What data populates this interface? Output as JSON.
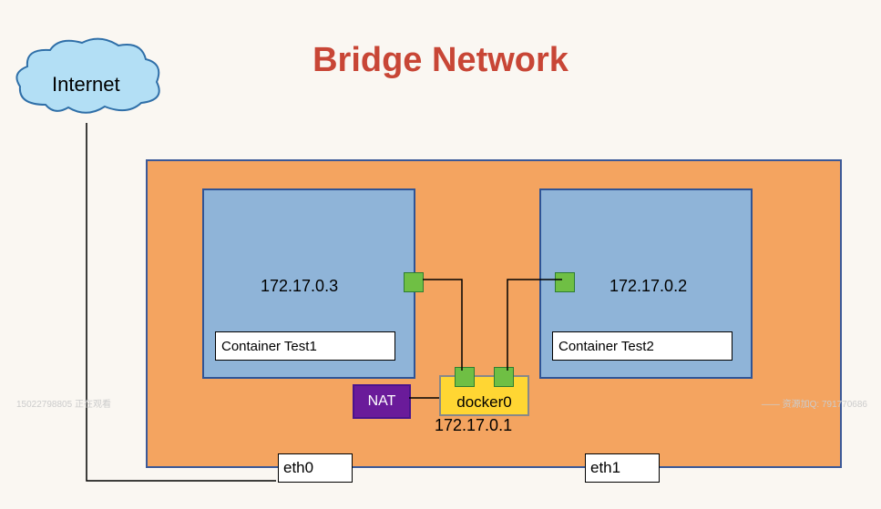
{
  "title": "Bridge Network",
  "internet": {
    "label": "Internet"
  },
  "host": {
    "containers": [
      {
        "name": "Container Test1",
        "ip": "172.17.0.3"
      },
      {
        "name": "Container Test2",
        "ip": "172.17.0.2"
      }
    ],
    "bridge": {
      "name": "docker0",
      "ip": "172.17.0.1"
    },
    "nat": {
      "label": "NAT"
    },
    "interfaces": [
      {
        "name": "eth0"
      },
      {
        "name": "eth1"
      }
    ]
  },
  "watermarks": {
    "left": "15022798805 正在观看",
    "right": "—— 资源加Q: 791770686"
  }
}
